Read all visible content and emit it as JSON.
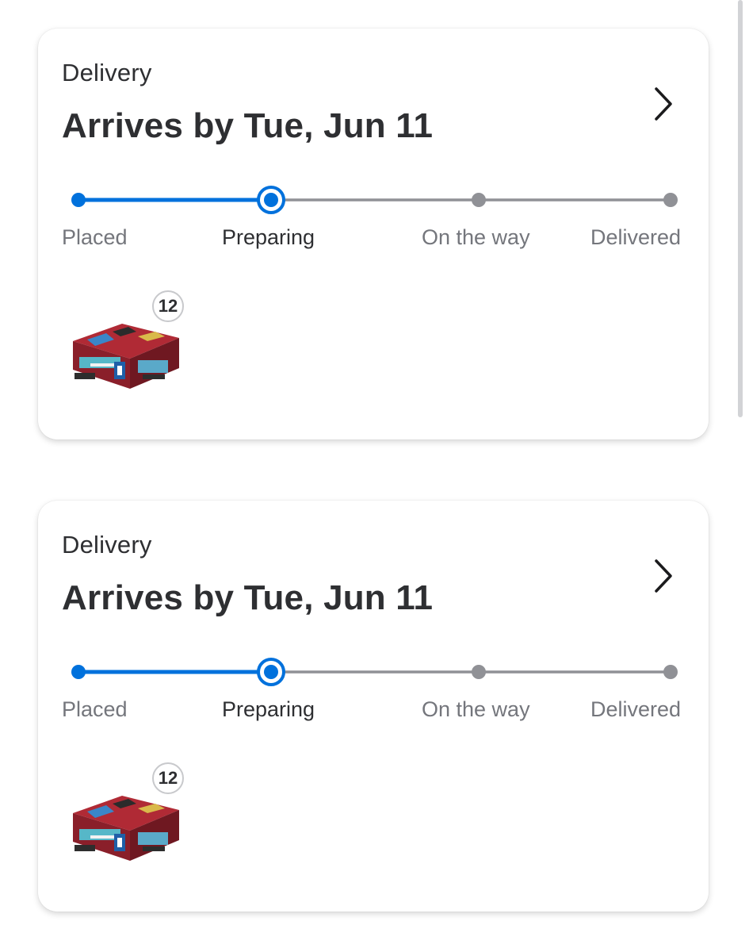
{
  "orders": [
    {
      "label": "Delivery",
      "title": "Arrives by Tue, Jun 11",
      "steps": [
        "Placed",
        "Preparing",
        "On the way",
        "Delivered"
      ],
      "current_step": "Preparing",
      "item_quantity": "12",
      "icons": [
        "chevron-right-icon",
        "product-thumbnail"
      ]
    },
    {
      "label": "Delivery",
      "title": "Arrives by Tue, Jun 11",
      "steps": [
        "Placed",
        "Preparing",
        "On the way",
        "Delivered"
      ],
      "current_step": "Preparing",
      "item_quantity": "12",
      "icons": [
        "chevron-right-icon",
        "product-thumbnail"
      ]
    }
  ],
  "colors": {
    "progress_active": "#0071dc",
    "progress_inactive": "#909196",
    "text_primary": "#2e2f32",
    "text_secondary": "#74767c"
  }
}
